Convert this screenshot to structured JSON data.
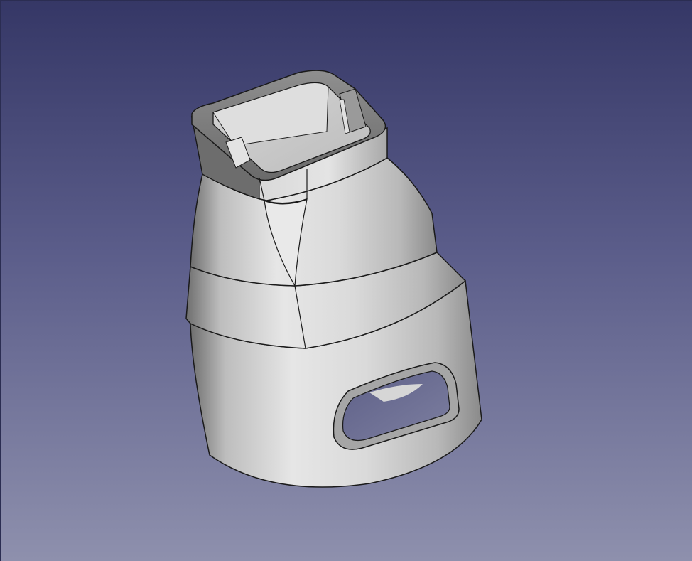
{
  "viewport": {
    "background_top": "#353766",
    "background_bottom": "#8e90ad"
  },
  "model": {
    "description_icon": "3d-part-icon",
    "body_color": "#c9c9c9",
    "edge_color": "#1a1a1a",
    "shadow_color": "#5a5a5a"
  }
}
